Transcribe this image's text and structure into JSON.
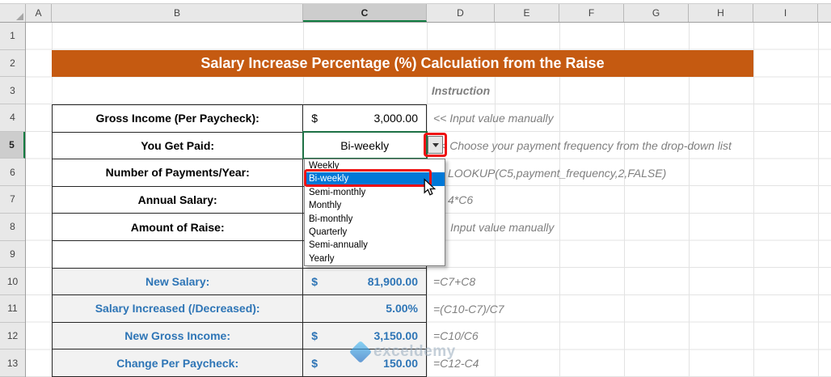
{
  "colors": {
    "banner_bg": "#C55A11",
    "banner_text": "#FFFFFF",
    "result_blue": "#2E75B6",
    "result_fill": "#F2F2F2",
    "note_gray": "#7F7F7F",
    "selection_green": "#1E7145",
    "dropdown_selection_blue": "#0078D7",
    "annotation_red": "#EE1111"
  },
  "grid": {
    "columns": [
      "A",
      "B",
      "C",
      "D",
      "E",
      "F",
      "G",
      "H",
      "I"
    ],
    "rows": [
      "1",
      "2",
      "3",
      "4",
      "5",
      "6",
      "7",
      "8",
      "9",
      "10",
      "11",
      "12",
      "13"
    ],
    "selected_column": "C",
    "selected_row": "5"
  },
  "banner": {
    "title": "Salary Increase Percentage (%) Calculation from the Raise"
  },
  "sheet": {
    "instruction_header": "Instruction",
    "input_rows": [
      {
        "label": "Gross Income (Per Paycheck):",
        "currency": "$",
        "value": "3,000.00",
        "note": "<< Input value manually"
      },
      {
        "label": "You Get Paid:",
        "value": "Bi-weekly",
        "note": "<< Choose your payment frequency from the drop-down list"
      },
      {
        "label": "Number of Payments/Year:",
        "note": "LOOKUP(C5,payment_frequency,2,FALSE)"
      },
      {
        "label": "Annual Salary:",
        "note": "4*C6"
      },
      {
        "label": "Amount of Raise:",
        "note": "Input value manually"
      }
    ],
    "result_rows": [
      {
        "label": "New Salary:",
        "currency": "$",
        "value": "81,900.00",
        "note": "=C7+C8"
      },
      {
        "label": "Salary Increased (/Decreased):",
        "value": "5.00%",
        "note": "=(C10-C7)/C7"
      },
      {
        "label": "New Gross Income:",
        "currency": "$",
        "value": "3,150.00",
        "note": "=C10/C6"
      },
      {
        "label": "Change Per Paycheck:",
        "currency": "$",
        "value": "150.00",
        "note": "=C12-C4"
      }
    ]
  },
  "dropdown": {
    "options": [
      "Weekly",
      "Bi-weekly",
      "Semi-monthly",
      "Monthly",
      "Bi-monthly",
      "Quarterly",
      "Semi-annually",
      "Yearly"
    ],
    "selected": "Bi-weekly"
  },
  "watermark": {
    "text": "exceldemy"
  }
}
